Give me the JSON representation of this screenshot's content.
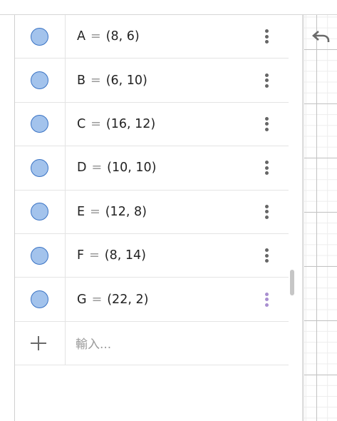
{
  "objects": [
    {
      "name": "A",
      "value": "(8, 6)"
    },
    {
      "name": "B",
      "value": "(6, 10)"
    },
    {
      "name": "C",
      "value": "(16, 12)"
    },
    {
      "name": "D",
      "value": "(10, 10)"
    },
    {
      "name": "E",
      "value": "(12, 8)"
    },
    {
      "name": "F",
      "value": "(8, 14)"
    },
    {
      "name": "G",
      "value": "(22, 2)"
    }
  ],
  "equals_sign": "=",
  "input": {
    "placeholder": "輸入..."
  },
  "icons": {
    "point_marble": "circle-icon",
    "menu": "more-vertical-icon",
    "add": "plus-icon",
    "undo": "undo-icon"
  },
  "colors": {
    "marble_fill": "#a3c3ec",
    "marble_stroke": "#3a73c4",
    "menu_dots": "#666666",
    "menu_dots_active": "#a98fd0",
    "grid_major": "#c2c2c2",
    "grid_minor": "#ededed"
  }
}
